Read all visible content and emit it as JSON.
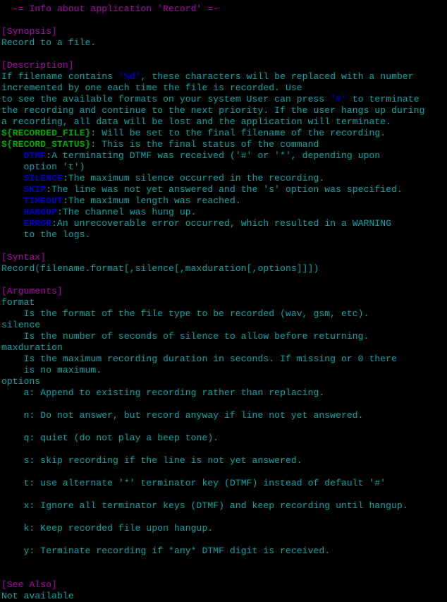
{
  "colors": {
    "text": "#00a8a8",
    "heading": "#b000b0",
    "highlight": "#0000c8",
    "variable": "#00a800",
    "background": "#000000"
  },
  "lines": [
    [
      [
        "m",
        "  -= Info about application 'Record' =-"
      ]
    ],
    [],
    [
      [
        "m",
        "[Synopsis]"
      ]
    ],
    [
      [
        "c",
        "Record to a file."
      ]
    ],
    [],
    [
      [
        "m",
        "[Description]"
      ]
    ],
    [
      [
        "c",
        "If filename contains "
      ],
      [
        "b",
        "'%d'"
      ],
      [
        "c",
        ", these characters will be replaced with a number"
      ]
    ],
    [
      [
        "c",
        "incremented by one each time the file is recorded. Use"
      ]
    ],
    [
      [
        "c",
        "to see the available formats on your system User can press "
      ],
      [
        "b",
        "'#'"
      ],
      [
        "c",
        " to terminate"
      ]
    ],
    [
      [
        "c",
        "the recording and continue to the next priority. If the user hangs up during"
      ]
    ],
    [
      [
        "c",
        "a recording, all data will be lost and the application will terminate."
      ]
    ],
    [
      [
        "g",
        "${RECORDED_FILE}"
      ],
      [
        "c",
        ": Will be set to the final filename of the recording."
      ]
    ],
    [
      [
        "g",
        "${RECORD_STATUS}"
      ],
      [
        "c",
        ": This is the final status of the command"
      ]
    ],
    [
      [
        "c",
        "    "
      ],
      [
        "b",
        "DTMF"
      ],
      [
        "c",
        ":A terminating DTMF was received ('#' or '*', depending upon"
      ]
    ],
    [
      [
        "c",
        "    option 't')"
      ]
    ],
    [
      [
        "c",
        "    "
      ],
      [
        "b",
        "SILENCE"
      ],
      [
        "c",
        ":The maximum silence occurred in the recording."
      ]
    ],
    [
      [
        "c",
        "    "
      ],
      [
        "b",
        "SKIP"
      ],
      [
        "c",
        ":The line was not yet answered and the 's' option was specified."
      ]
    ],
    [
      [
        "c",
        "    "
      ],
      [
        "b",
        "TIMEOUT"
      ],
      [
        "c",
        ":The maximum length was reached."
      ]
    ],
    [
      [
        "c",
        "    "
      ],
      [
        "b",
        "HANGUP"
      ],
      [
        "c",
        ":The channel was hung up."
      ]
    ],
    [
      [
        "c",
        "    "
      ],
      [
        "b",
        "ERROR"
      ],
      [
        "c",
        ":An unrecoverable error occurred, which resulted in a WARNING"
      ]
    ],
    [
      [
        "c",
        "    to the logs."
      ]
    ],
    [],
    [
      [
        "m",
        "[Syntax]"
      ]
    ],
    [
      [
        "c",
        "Record(filename.format[,silence[,maxduration[,options]]])"
      ]
    ],
    [],
    [
      [
        "m",
        "[Arguments]"
      ]
    ],
    [
      [
        "c",
        "format"
      ]
    ],
    [
      [
        "c",
        "    Is the format of the file type to be recorded (wav, gsm, etc)."
      ]
    ],
    [
      [
        "c",
        "silence"
      ]
    ],
    [
      [
        "c",
        "    Is the number of seconds of silence to allow before returning."
      ]
    ],
    [
      [
        "c",
        "maxduration"
      ]
    ],
    [
      [
        "c",
        "    Is the maximum recording duration in seconds. If missing or 0 there"
      ]
    ],
    [
      [
        "c",
        "    is no maximum."
      ]
    ],
    [
      [
        "c",
        "options"
      ]
    ],
    [
      [
        "c",
        "    a: Append to existing recording rather than replacing."
      ]
    ],
    [],
    [
      [
        "c",
        "    n: Do not answer, but record anyway if line not yet answered."
      ]
    ],
    [],
    [
      [
        "c",
        "    q: quiet (do not play a beep tone)."
      ]
    ],
    [],
    [
      [
        "c",
        "    s: skip recording if the line is not yet answered."
      ]
    ],
    [],
    [
      [
        "c",
        "    t: use alternate '*' terminator key (DTMF) instead of default '#'"
      ]
    ],
    [],
    [
      [
        "c",
        "    x: Ignore all terminator keys (DTMF) and keep recording until hangup."
      ]
    ],
    [],
    [
      [
        "c",
        "    k: Keep recorded file upon hangup."
      ]
    ],
    [],
    [
      [
        "c",
        "    y: Terminate recording if *any* DTMF digit is received."
      ]
    ],
    [],
    [],
    [
      [
        "m",
        "[See Also]"
      ]
    ],
    [
      [
        "c",
        "Not available"
      ]
    ]
  ]
}
